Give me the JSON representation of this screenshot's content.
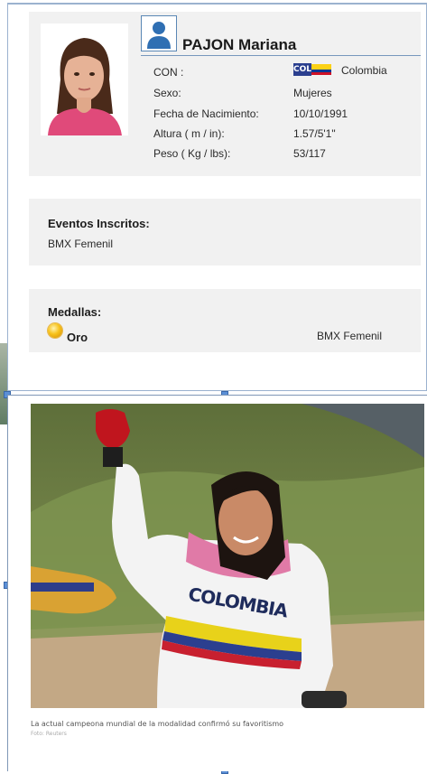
{
  "profile": {
    "name": "PAJON Mariana",
    "fields": [
      {
        "label": "CON :",
        "value": "Colombia",
        "type": "flag"
      },
      {
        "label": "Sexo:",
        "value": "Mujeres"
      },
      {
        "label": "Fecha de Nacimiento:",
        "value": "10/10/1991"
      },
      {
        "label": "Altura ( m / in):",
        "value": "1.57/5'1\""
      },
      {
        "label": "Peso ( Kg / lbs):",
        "value": "53/117"
      }
    ],
    "flag_code": "COL",
    "flag_colors": [
      "#fcd116",
      "#003893",
      "#ce1126"
    ],
    "icons": {
      "user": "user-silhouette-icon"
    }
  },
  "events": {
    "title": "Eventos Inscritos:",
    "items": [
      "BMX Femenil"
    ]
  },
  "medals": {
    "title": "Medallas:",
    "items": [
      {
        "medal": "Oro",
        "event": "BMX Femenil",
        "icon": "gold-medal-icon"
      }
    ]
  },
  "photo": {
    "caption": "La actual campeona mundial de la modalidad confirmó su favoritismo",
    "credit": "Foto: Reuters",
    "jersey_text": "COLOMBIA"
  },
  "colors": {
    "panel_bg": "#f1f1f1",
    "border": "#9bb2cf",
    "handle": "#5b8fd6"
  }
}
